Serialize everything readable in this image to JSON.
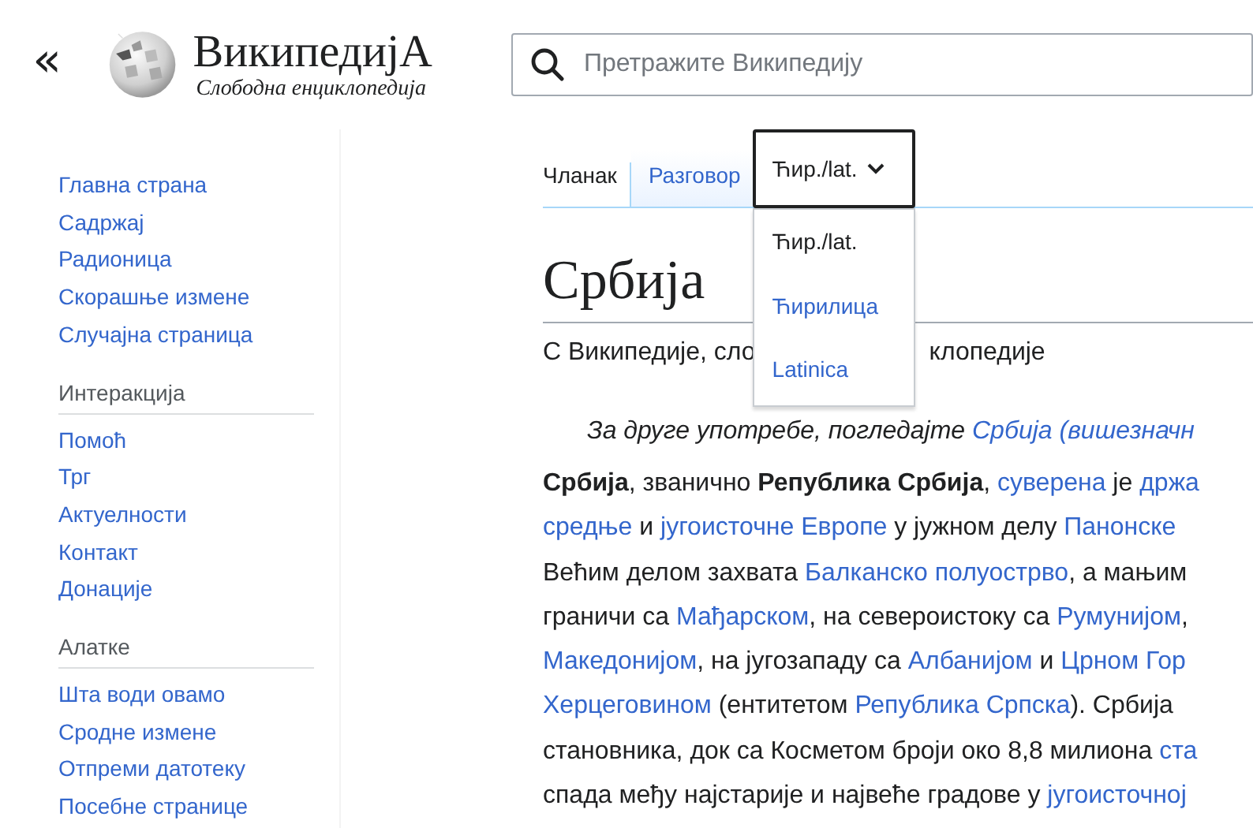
{
  "header": {
    "collapse_icon": "«",
    "wordmark": "ВикипедијА",
    "tagline": "Слободна енциклопедија",
    "search": {
      "placeholder": "Претражите Википедију"
    }
  },
  "sidebar": {
    "sections": [
      {
        "items": [
          "Главна страна",
          "Садржај",
          "Радионица",
          "Скорашње измене",
          "Случајна страница"
        ]
      },
      {
        "heading": "Интеракција",
        "items": [
          "Помоћ",
          "Трг",
          "Актуелности",
          "Контакт",
          "Донације"
        ]
      },
      {
        "heading": "Алатке",
        "items": [
          "Шта води овамо",
          "Сродне измене",
          "Отпреми датотеку",
          "Посебне странице"
        ]
      }
    ]
  },
  "tabs": [
    {
      "label": "Чланак",
      "selected": true
    },
    {
      "label": "Разговор",
      "selected": false
    }
  ],
  "variant_dropdown": {
    "label": "Ћир./lat.",
    "expanded": true,
    "options": [
      {
        "label": "Ћир./lat.",
        "selected": true
      },
      {
        "label": "Ћирилица",
        "selected": false
      },
      {
        "label": "Latinica",
        "selected": false
      }
    ]
  },
  "article": {
    "title": "Србија",
    "subtitle_parts": [
      "С Википедије, сло",
      "клопедије"
    ],
    "hatnote": [
      {
        "kind": "text",
        "text": "За друге употребе, погледајте "
      },
      {
        "kind": "link",
        "text": "Србија (вишезначн"
      }
    ],
    "lines": [
      [
        {
          "kind": "bold",
          "text": "Србија"
        },
        {
          "kind": "text",
          "text": ", званично "
        },
        {
          "kind": "bold",
          "text": "Република Србија"
        },
        {
          "kind": "text",
          "text": ", "
        },
        {
          "kind": "link",
          "text": "суверена"
        },
        {
          "kind": "text",
          "text": " је "
        },
        {
          "kind": "link",
          "text": "држа"
        }
      ],
      [
        {
          "kind": "link",
          "text": "средње"
        },
        {
          "kind": "text",
          "text": " и "
        },
        {
          "kind": "link",
          "text": "југоисточне Европе"
        },
        {
          "kind": "text",
          "text": " у јужном делу "
        },
        {
          "kind": "link",
          "text": "Панонске"
        }
      ],
      [
        {
          "kind": "text",
          "text": "Већим делом захвата "
        },
        {
          "kind": "link",
          "text": "Балканско полуострво"
        },
        {
          "kind": "text",
          "text": ", а мањим"
        }
      ],
      [
        {
          "kind": "text",
          "text": "граничи са "
        },
        {
          "kind": "link",
          "text": "Мађарском"
        },
        {
          "kind": "text",
          "text": ", на североистоку са "
        },
        {
          "kind": "link",
          "text": "Румунијом"
        },
        {
          "kind": "text",
          "text": ","
        }
      ],
      [
        {
          "kind": "link",
          "text": "Македонијом"
        },
        {
          "kind": "text",
          "text": ", на југозападу са "
        },
        {
          "kind": "link",
          "text": "Албанијом"
        },
        {
          "kind": "text",
          "text": " и "
        },
        {
          "kind": "link",
          "text": "Црном Гор"
        }
      ],
      [
        {
          "kind": "link",
          "text": "Херцеговином"
        },
        {
          "kind": "text",
          "text": " (ентитетом "
        },
        {
          "kind": "link",
          "text": "Република Српска"
        },
        {
          "kind": "text",
          "text": "). Србија"
        }
      ],
      [
        {
          "kind": "text",
          "text": "становника, док са Косметом броји око 8,8 милиона "
        },
        {
          "kind": "link",
          "text": "ста"
        }
      ],
      [
        {
          "kind": "text",
          "text": "спада међу најстарије и највеће градове у "
        },
        {
          "kind": "link",
          "text": "југоисточној"
        }
      ]
    ]
  }
}
